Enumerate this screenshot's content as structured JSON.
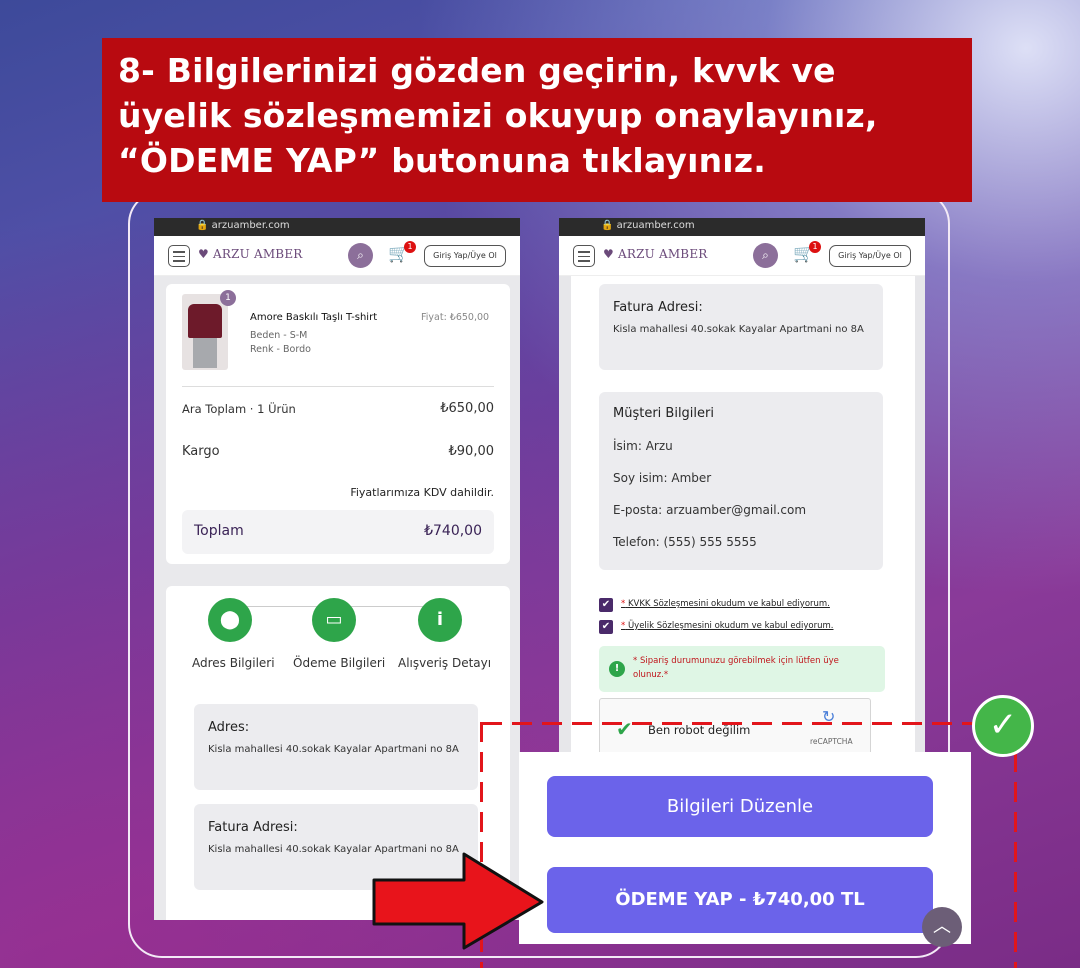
{
  "banner": {
    "line1": "8- Bilgilerinizi gözden geçirin, kvvk ve",
    "line2": "üyelik sözleşmemizi okuyup onaylayınız,",
    "line3": "“ÖDEME YAP” butonuna tıklayınız."
  },
  "browser": {
    "url": "arzuamber.com"
  },
  "header": {
    "logo": "ARZU AMBER",
    "login_label": "Giriş Yap/Üye Ol",
    "cart_count": "1"
  },
  "product": {
    "name": "Amore Baskılı Taşlı T-shirt",
    "price": "Fiyat: ₺650,00",
    "size": "Beden - S-M",
    "color": "Renk - Bordo",
    "qty_badge": "1"
  },
  "summary": {
    "subtotal_label": "Ara Toplam · 1 Ürün",
    "subtotal_value": "₺650,00",
    "shipping_label": "Kargo",
    "shipping_value": "₺90,00",
    "vat_note": "Fiyatlarımıza KDV dahildir.",
    "total_label": "Toplam",
    "total_value": "₺740,00"
  },
  "steps": [
    {
      "label": "Adres Bilgileri",
      "icon": "location-icon"
    },
    {
      "label": "Ödeme Bilgileri",
      "icon": "card-icon"
    },
    {
      "label": "Alışveriş Detayı",
      "icon": "info-icon"
    }
  ],
  "address": {
    "title": "Adres:",
    "text": "Kisla mahallesi 40.sokak Kayalar Apartmani no 8A"
  },
  "billing": {
    "title": "Fatura Adresi:",
    "text": "Kisla mahallesi 40.sokak Kayalar Apartmani no 8A"
  },
  "customer": {
    "title": "Müşteri Bilgileri",
    "name_label": "İsim:",
    "name": "Arzu",
    "surname_label": "Soy isim:",
    "surname": "Amber",
    "email_label": "E-posta:",
    "email": "arzuamber@gmail.com",
    "phone_label": "Telefon:",
    "phone": "(555) 555 5555"
  },
  "consents": {
    "kvkk": "KVKK Sözleşmesini okudum ve kabul ediyorum.",
    "membership": "Üyelik Sözleşmesini okudum ve kabul ediyorum.",
    "star": "*"
  },
  "alert": {
    "text": "* Sipariş durumunuzu görebilmek için lütfen üye olunuz.*"
  },
  "captcha": {
    "label": "Ben robot değilim",
    "brand": "reCAPTCHA"
  },
  "actions": {
    "edit_label": "Bilgileri Düzenle",
    "pay_label": "ÖDEME YAP - ₺740,00 TL"
  },
  "colors": {
    "banner": "#b80a10",
    "button": "#6b63ea",
    "step": "#2ea54a",
    "dash": "#e2151b"
  }
}
